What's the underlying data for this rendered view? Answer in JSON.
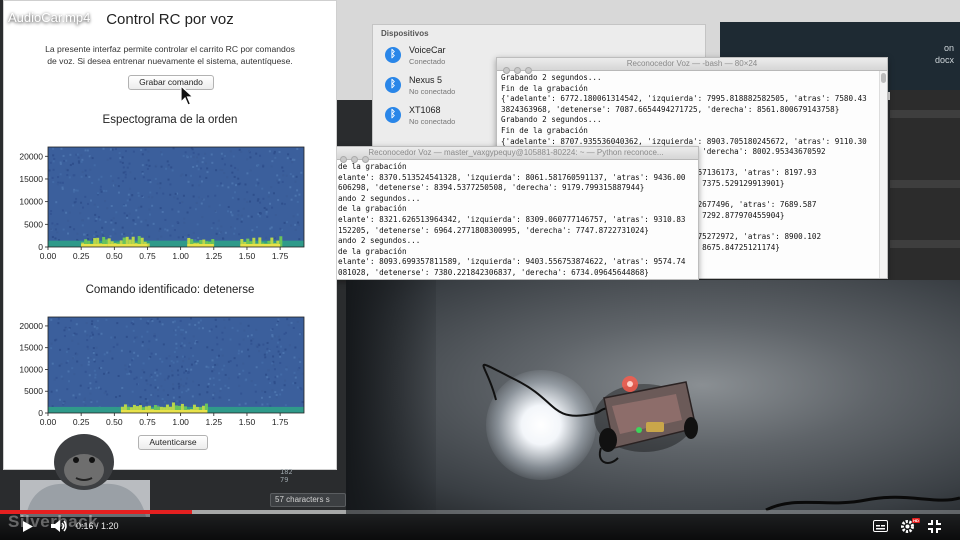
{
  "video": {
    "title": "AudioCar.mp4",
    "time_current": "0:16",
    "time_separator": " / ",
    "time_total": "1:20",
    "played_fraction": 0.2,
    "loaded_fraction": 0.36,
    "watermark": "Silverback",
    "hd_badge": "HD"
  },
  "app": {
    "title": "Control RC por voz",
    "description_line1": "La presente interfaz permite controlar el carrito RC por comandos",
    "description_line2": "de voz. Si desea entrenar nuevamente el sistema, autentíquese.",
    "record_button": "Grabar comando",
    "auth_button": "Autenticarse",
    "chart1_title": "Espectograma de la orden",
    "chart2_title": "Comando identificado: detenerse"
  },
  "chart_data": [
    {
      "type": "heatmap",
      "title": "Espectograma de la orden",
      "x_ticks": [
        "0.00",
        "0.25",
        "0.50",
        "0.75",
        "1.00",
        "1.25",
        "1.50",
        "1.75"
      ],
      "y_ticks": [
        "0",
        "5000",
        "10000",
        "15000",
        "20000"
      ],
      "xlim": [
        0,
        1.93
      ],
      "ylim": [
        0,
        22050
      ],
      "energy_band_hz": [
        0,
        1400
      ],
      "bursts": [
        [
          0.25,
          0.45
        ],
        [
          0.45,
          0.75
        ],
        [
          1.05,
          1.25
        ],
        [
          1.45,
          1.75
        ]
      ]
    },
    {
      "type": "heatmap",
      "title": "Comando identificado: detenerse",
      "x_ticks": [
        "0.00",
        "0.25",
        "0.50",
        "0.75",
        "1.00",
        "1.25",
        "1.50",
        "1.75"
      ],
      "y_ticks": [
        "0",
        "5000",
        "10000",
        "15000",
        "20000"
      ],
      "xlim": [
        0,
        1.93
      ],
      "ylim": [
        0,
        22050
      ],
      "energy_band_hz": [
        0,
        1400
      ],
      "bursts": [
        [
          0.55,
          1.2
        ]
      ]
    }
  ],
  "bluetooth": {
    "header": "Dispositivos",
    "devices": [
      {
        "name": "VoiceCar",
        "status": "Conectado"
      },
      {
        "name": "Nexus 5",
        "status": "No conectado"
      },
      {
        "name": "XT1068",
        "status": "No conectado"
      }
    ]
  },
  "terminal1": {
    "title": "Reconocedor Voz — -bash — 80×24",
    "lines": [
      "Grabando 2 segundos...",
      "Fin de la grabación",
      "{'adelante': 6772.180061314542, 'izquierda': 7995.818882582505, 'atras': 7580.43",
      "3824363968, 'detenerse': 7087.6654494271725, 'derecha': 8561.800679143758}",
      "Grabando 2 segundos...",
      "Fin de la grabación",
      "{'adelante': 8707.935536040362, 'izquierda': 8903.705180245672, 'atras': 9110.30",
      "6867449836, 'detenerse': 8645.511036466415, 'derecha': 8002.95343670592",
      "",
      "                                  8368.289657136173, 'atras': 8197.93",
      "                                 'derecha': 7375.529129913901}",
      "",
      "                                  8729.85412677496, 'atras': 7689.587",
      "                                 'derecha': 7292.877970455904}",
      "",
      "                                  8463.182975272972, 'atras': 8900.102",
      "                                 'derecha': 8675.84725121174}",
      "                                 ocedor.py"
    ]
  },
  "terminal2": {
    "title": "Reconocedor Voz — master_vaxgypequy@105881-80224: ~ — Python reconoce...",
    "lines": [
      "de la grabación",
      "elante': 8370.513524541328, 'izquierda': 8061.581760591137, 'atras': 9436.00",
      "606298, 'detenerse': 8394.5377250508, 'derecha': 9179.799315887944}",
      "ando 2 segundos...",
      "de la grabación",
      "elante': 8321.626513964342, 'izquierda': 8309.060777146757, 'atras': 9310.83",
      "152205, 'detenerse': 6964.2771808300995, 'derecha': 7747.8722731024}",
      "ando 2 segundos...",
      "de la grabación",
      "elante': 8093.699357811589, 'izquierda': 9403.556753874622, 'atras': 9574.74",
      "081028, 'detenerse': 7380.221842306837, 'derecha': 6734.09645644868}",
      "ando 2 segundos..."
    ]
  },
  "background": {
    "edge_line1": "on",
    "edge_line2": "docx",
    "char_count": "57 characters s",
    "scrap1": "182",
    "scrap2": "79"
  }
}
